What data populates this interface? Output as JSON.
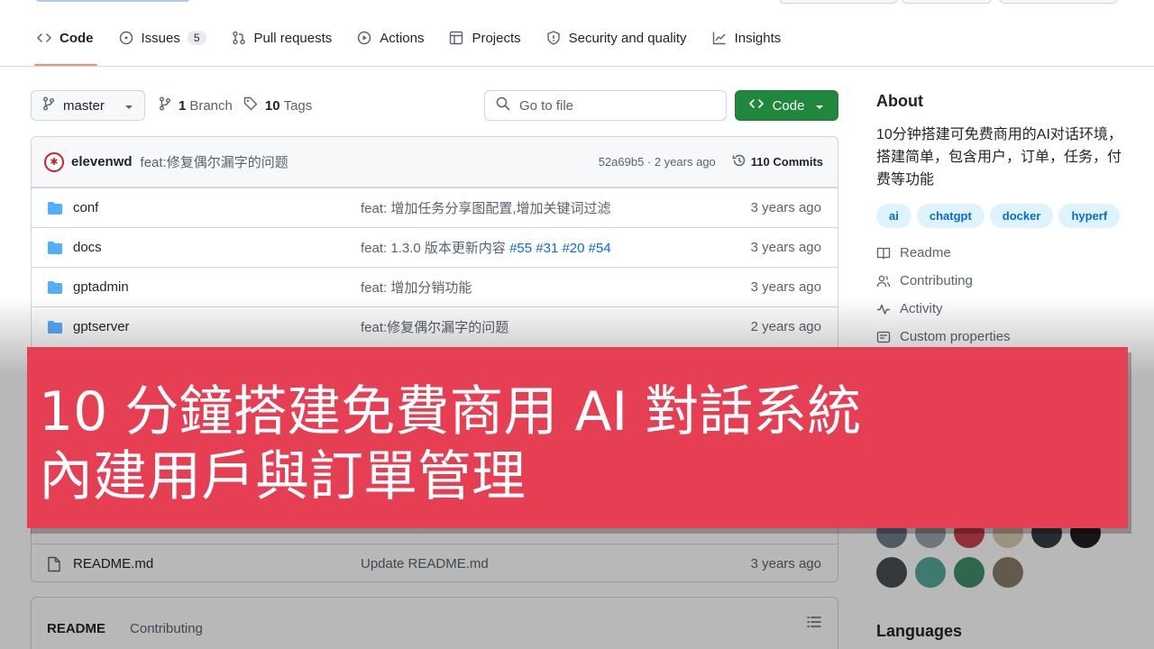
{
  "nav": {
    "items": [
      {
        "label": "Code",
        "icon": "code-icon",
        "selected": true
      },
      {
        "label": "Issues",
        "icon": "issue-icon",
        "count": "5"
      },
      {
        "label": "Pull requests",
        "icon": "pull-request-icon"
      },
      {
        "label": "Actions",
        "icon": "play-icon"
      },
      {
        "label": "Projects",
        "icon": "table-icon"
      },
      {
        "label": "Security and quality",
        "icon": "shield-icon"
      },
      {
        "label": "Insights",
        "icon": "graph-icon"
      }
    ]
  },
  "toolbar": {
    "branch": "master",
    "branch_count": "1",
    "branch_label": "Branch",
    "tag_count": "10",
    "tag_label": "Tags",
    "goto_placeholder": "Go to file",
    "code_button": "Code"
  },
  "commit": {
    "author": "elevenwd",
    "message": "feat:修复偶尔漏字的问题",
    "sha_time": "52a69b5 · 2 years ago",
    "count": "110 Commits"
  },
  "files": [
    {
      "name": "conf",
      "type": "folder",
      "message": "feat: 增加任务分享图配置,增加关键词过滤",
      "links": "",
      "age": "3 years ago"
    },
    {
      "name": "docs",
      "type": "folder",
      "message": "feat: 1.3.0 版本更新内容 ",
      "links": "#55 #31 #20 #54",
      "age": "3 years ago"
    },
    {
      "name": "gptadmin",
      "type": "folder",
      "message": "feat: 增加分销功能",
      "links": "",
      "age": "3 years ago"
    },
    {
      "name": "gptserver",
      "type": "folder",
      "message": "feat:修复偶尔漏字的问题",
      "links": "",
      "age": "2 years ago"
    }
  ],
  "readme_file": {
    "name": "README.md",
    "message": "Update README.md",
    "age": "3 years ago"
  },
  "readme_tabs": [
    "README",
    "Contributing"
  ],
  "about": {
    "title": "About",
    "description": "10分钟搭建可免费商用的AI对话环境，搭建简单，包含用户，订单，任务，付费等功能",
    "topics": [
      "ai",
      "chatgpt",
      "docker",
      "hyperf"
    ],
    "links": [
      {
        "label": "Readme",
        "icon": "book-icon"
      },
      {
        "label": "Contributing",
        "icon": "people-icon"
      },
      {
        "label": "Activity",
        "icon": "pulse-icon"
      },
      {
        "label": "Custom properties",
        "icon": "note-icon"
      }
    ]
  },
  "languages_title": "Languages",
  "caption": {
    "line1": "10 分鐘搭建免費商用 AI 對話系統",
    "line2": "內建用戶與訂單管理"
  },
  "colors": {
    "caption_bg": "#e63e53",
    "primary_button": "#1f883d",
    "link": "#0969da",
    "folder": "#54aeff"
  }
}
